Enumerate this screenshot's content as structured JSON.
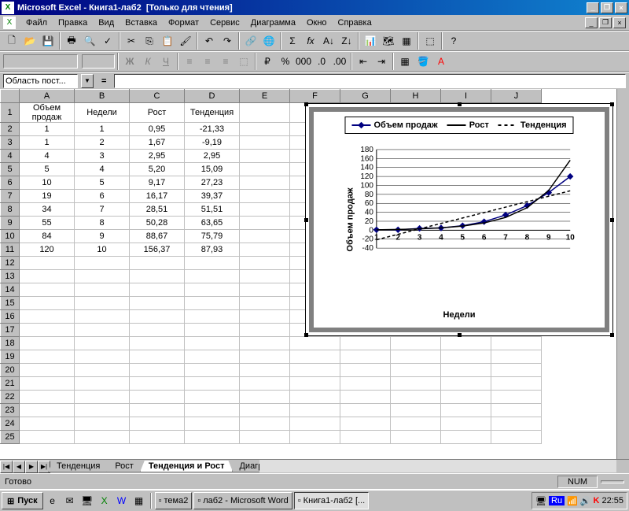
{
  "titlebar": {
    "app": "Microsoft Excel",
    "doc": "Книга1-лаб2",
    "readonly": "[Только для чтения]"
  },
  "menu": [
    "Файл",
    "Правка",
    "Вид",
    "Вставка",
    "Формат",
    "Сервис",
    "Диаграмма",
    "Окно",
    "Справка"
  ],
  "name_box": "Область пост...",
  "columns": [
    "A",
    "B",
    "C",
    "D",
    "E",
    "F",
    "G",
    "H",
    "I",
    "J"
  ],
  "headers": {
    "A": "Объем продаж",
    "B": "Недели",
    "C": "Рост",
    "D": "Тенденция"
  },
  "rows": [
    {
      "a": "1",
      "b": "1",
      "c": "0,95",
      "d": "-21,33"
    },
    {
      "a": "1",
      "b": "2",
      "c": "1,67",
      "d": "-9,19"
    },
    {
      "a": "4",
      "b": "3",
      "c": "2,95",
      "d": "2,95"
    },
    {
      "a": "5",
      "b": "4",
      "c": "5,20",
      "d": "15,09"
    },
    {
      "a": "10",
      "b": "5",
      "c": "9,17",
      "d": "27,23"
    },
    {
      "a": "19",
      "b": "6",
      "c": "16,17",
      "d": "39,37"
    },
    {
      "a": "34",
      "b": "7",
      "c": "28,51",
      "d": "51,51"
    },
    {
      "a": "55",
      "b": "8",
      "c": "50,28",
      "d": "63,65"
    },
    {
      "a": "84",
      "b": "9",
      "c": "88,67",
      "d": "75,79"
    },
    {
      "a": "120",
      "b": "10",
      "c": "156,37",
      "d": "87,93"
    }
  ],
  "chart_data": {
    "type": "line",
    "title": "",
    "xlabel": "Недели",
    "ylabel": "Объем продаж",
    "x": [
      1,
      2,
      3,
      4,
      5,
      6,
      7,
      8,
      9,
      10
    ],
    "ylim": [
      -40,
      180
    ],
    "yticks": [
      -40,
      -20,
      0,
      20,
      40,
      60,
      80,
      100,
      120,
      140,
      160,
      180
    ],
    "series": [
      {
        "name": "Объем продаж",
        "values": [
          1,
          1,
          4,
          5,
          10,
          19,
          34,
          55,
          84,
          120
        ],
        "style": "diamond"
      },
      {
        "name": "Рост",
        "values": [
          0.95,
          1.67,
          2.95,
          5.2,
          9.17,
          16.17,
          28.51,
          50.28,
          88.67,
          156.37
        ],
        "style": "solid"
      },
      {
        "name": "Тенденция",
        "values": [
          -21.33,
          -9.19,
          2.95,
          15.09,
          27.23,
          39.37,
          51.51,
          63.65,
          75.79,
          87.93
        ],
        "style": "dashed"
      }
    ]
  },
  "sheet_tabs": [
    "Тенденция",
    "Рост",
    "Тенденция и Рост",
    "Диаграмма"
  ],
  "active_tab": 2,
  "status": {
    "ready": "Готово",
    "num": "NUM"
  },
  "taskbar": {
    "start": "Пуск",
    "tasks": [
      {
        "label": "тема2",
        "active": false
      },
      {
        "label": "лаб2 - Microsoft Word",
        "active": false
      },
      {
        "label": "Книга1-лаб2  [...",
        "active": true
      }
    ],
    "lang": "Ru",
    "clock": "22:55"
  }
}
